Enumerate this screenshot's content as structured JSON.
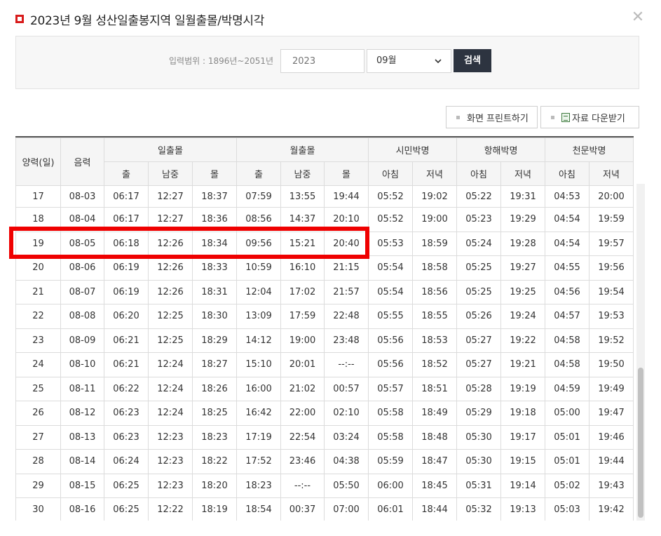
{
  "header": {
    "title": "2023년 9월 성산일출봉지역 일월출몰/박명시각",
    "close_glyph": "✕"
  },
  "search": {
    "range_label": "입력범위 : 1896년~2051년",
    "year_placeholder": "2023",
    "month_selected": "09월",
    "submit_label": "검색"
  },
  "toolbar": {
    "print_label": "화면 프린트하기",
    "download_label": "자료 다운받기"
  },
  "table": {
    "headers": {
      "solar_day": "양력(일)",
      "lunar": "음력",
      "sun_group": "일출몰",
      "moon_group": "월출몰",
      "civil_group": "시민박명",
      "nautical_group": "항해박명",
      "astro_group": "천문박명",
      "rise": "출",
      "transit": "남중",
      "set": "몰",
      "morning": "아침",
      "evening": "저녁"
    },
    "rows": [
      [
        "17",
        "08-03",
        "06:17",
        "12:27",
        "18:37",
        "07:59",
        "13:55",
        "19:44",
        "05:52",
        "19:02",
        "05:22",
        "19:31",
        "04:53",
        "20:00"
      ],
      [
        "18",
        "08-04",
        "06:17",
        "12:27",
        "18:36",
        "08:56",
        "14:37",
        "20:10",
        "05:52",
        "19:00",
        "05:23",
        "19:29",
        "04:54",
        "19:59"
      ],
      [
        "19",
        "08-05",
        "06:18",
        "12:26",
        "18:34",
        "09:56",
        "15:21",
        "20:40",
        "05:53",
        "18:59",
        "05:24",
        "19:28",
        "04:54",
        "19:57"
      ],
      [
        "20",
        "08-06",
        "06:19",
        "12:26",
        "18:33",
        "10:59",
        "16:10",
        "21:15",
        "05:54",
        "18:58",
        "05:25",
        "19:27",
        "04:55",
        "19:56"
      ],
      [
        "21",
        "08-07",
        "06:19",
        "12:26",
        "18:31",
        "12:04",
        "17:02",
        "21:57",
        "05:54",
        "18:56",
        "05:25",
        "19:25",
        "04:56",
        "19:54"
      ],
      [
        "22",
        "08-08",
        "06:20",
        "12:25",
        "18:30",
        "13:09",
        "17:59",
        "22:48",
        "05:55",
        "18:55",
        "05:26",
        "19:24",
        "04:57",
        "19:53"
      ],
      [
        "23",
        "08-09",
        "06:21",
        "12:25",
        "18:29",
        "14:12",
        "19:00",
        "23:48",
        "05:56",
        "18:53",
        "05:27",
        "19:22",
        "04:58",
        "19:52"
      ],
      [
        "24",
        "08-10",
        "06:21",
        "12:24",
        "18:27",
        "15:10",
        "20:01",
        "--:--",
        "05:56",
        "18:52",
        "05:27",
        "19:21",
        "04:58",
        "19:50"
      ],
      [
        "25",
        "08-11",
        "06:22",
        "12:24",
        "18:26",
        "16:00",
        "21:02",
        "00:57",
        "05:57",
        "18:51",
        "05:28",
        "19:19",
        "04:59",
        "19:49"
      ],
      [
        "26",
        "08-12",
        "06:23",
        "12:24",
        "18:25",
        "16:42",
        "22:00",
        "02:10",
        "05:58",
        "18:49",
        "05:29",
        "19:18",
        "05:00",
        "19:47"
      ],
      [
        "27",
        "08-13",
        "06:23",
        "12:23",
        "18:23",
        "17:19",
        "22:54",
        "03:24",
        "05:58",
        "18:48",
        "05:30",
        "19:17",
        "05:01",
        "19:46"
      ],
      [
        "28",
        "08-14",
        "06:24",
        "12:23",
        "18:22",
        "17:52",
        "23:46",
        "04:38",
        "05:59",
        "18:47",
        "05:30",
        "19:15",
        "05:01",
        "19:44"
      ],
      [
        "29",
        "08-15",
        "06:25",
        "12:23",
        "18:20",
        "18:23",
        "--:--",
        "05:50",
        "06:00",
        "18:45",
        "05:31",
        "19:14",
        "05:02",
        "19:43"
      ],
      [
        "30",
        "08-16",
        "06:25",
        "12:22",
        "18:19",
        "18:54",
        "00:37",
        "07:00",
        "06:01",
        "18:44",
        "05:32",
        "19:13",
        "05:03",
        "19:42"
      ]
    ]
  },
  "colors": {
    "title_marker": "#d81b1b",
    "highlight_box": "#ef0000",
    "search_button_bg": "#2d3440"
  }
}
